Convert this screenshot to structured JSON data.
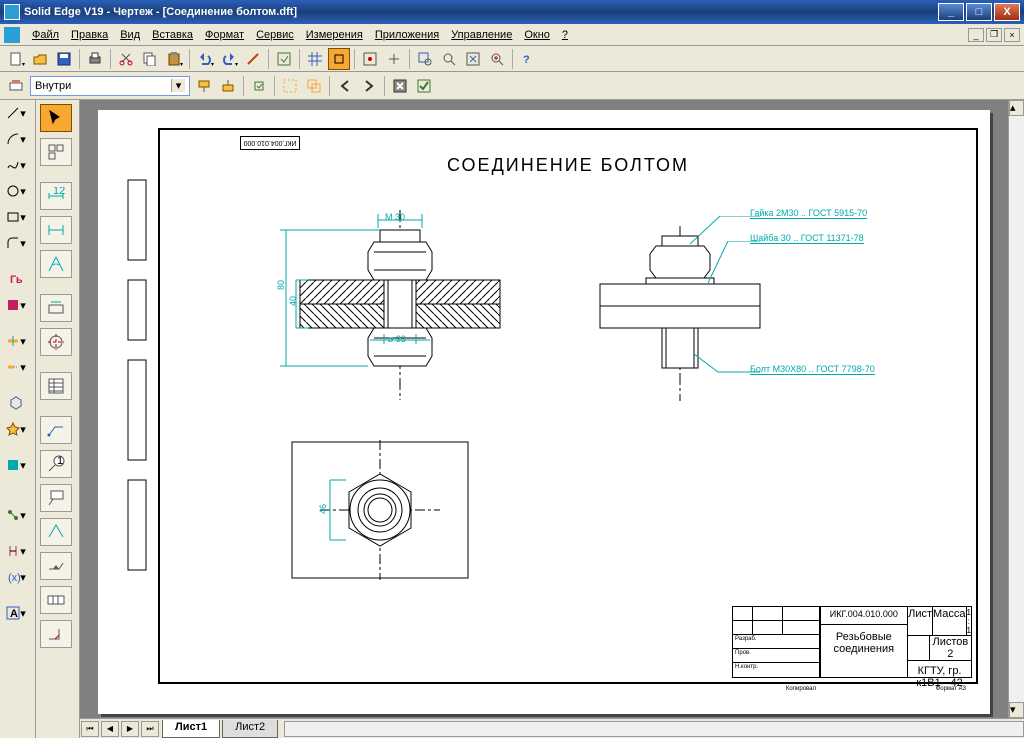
{
  "app": {
    "title": "Solid Edge V19 - Чертеж - [Соединение болтом.dft]"
  },
  "menu": {
    "items": [
      "Файл",
      "Правка",
      "Вид",
      "Вставка",
      "Формат",
      "Сервис",
      "Измерения",
      "Приложения",
      "Управление",
      "Окно",
      "?"
    ]
  },
  "ribbon": {
    "selector_value": "Внутри"
  },
  "drawing": {
    "title": "СОЕДИНЕНИЕ БОЛТОМ",
    "code": "ИКГ.004.010.000",
    "dims": {
      "m30": "М 30",
      "d33": "⌀ 33",
      "h80": "80",
      "h40": "40",
      "h46": "46"
    },
    "annotations": {
      "nut": "Гайка 2М30 .. ГОСТ 5915-70",
      "washer": "Шайба 30 .. ГОСТ 11371-78",
      "bolt": "Болт М30Х80 .. ГОСТ 7798-70"
    },
    "titleblock": {
      "number": "ИКГ.004.010.000",
      "name1": "Резьбовые",
      "name2": "соединения",
      "scale": "1 : 1",
      "sheet": "Лист",
      "mass": "Масса",
      "format": "Формат  А3",
      "org": "КГТУ, гр. к1В1 - 42",
      "copied": "Копировал"
    }
  },
  "sheets": {
    "active": "Лист1",
    "tabs": [
      "Лист1",
      "Лист2"
    ]
  }
}
